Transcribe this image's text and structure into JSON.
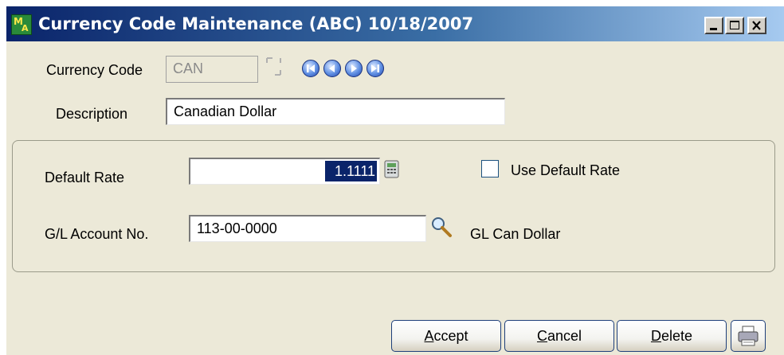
{
  "window": {
    "title": "Currency Code Maintenance (ABC) 10/18/2007",
    "controls": [
      "minimize-icon",
      "maximize-icon",
      "close-icon"
    ]
  },
  "form": {
    "currency_code_label": "Currency Code",
    "currency_code_value": "CAN",
    "description_label": "Description",
    "description_value": "Canadian Dollar",
    "navigation_icons": [
      "first-record-icon",
      "previous-record-icon",
      "next-record-icon",
      "last-record-icon"
    ]
  },
  "group": {
    "default_rate_label": "Default Rate",
    "default_rate_value": "1.1111",
    "use_default_rate_label": "Use Default Rate",
    "use_default_rate_checked": false,
    "gl_account_label": "G/L Account No.",
    "gl_account_value": "113-00-0000",
    "gl_account_description": "GL Can Dollar"
  },
  "buttons": {
    "accept_label": "Accept",
    "cancel_label": "Cancel",
    "delete_label": "Delete"
  },
  "colors": {
    "title_gradient_start": "#0a246a",
    "title_gradient_end": "#a6caf0",
    "window_bg": "#ece9d8",
    "selection": "#0a246a"
  }
}
